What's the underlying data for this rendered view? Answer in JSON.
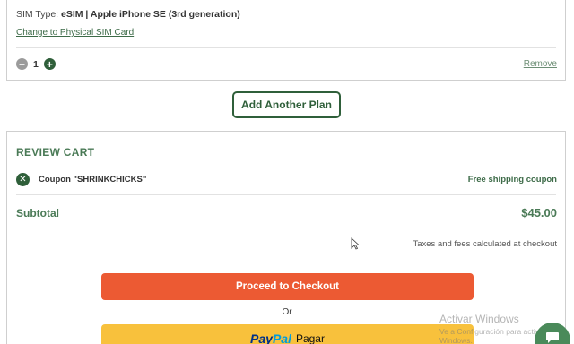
{
  "plan": {
    "sim_type_label": "SIM Type:",
    "sim_type_value": "eSIM | Apple iPhone SE (3rd generation)",
    "change_sim_link": "Change to Physical SIM Card",
    "quantity": "1",
    "remove_link": "Remove"
  },
  "add_plan_button": "Add Another Plan",
  "review": {
    "title": "REVIEW CART",
    "coupon_label": "Coupon \"SHRINKCHICKS\"",
    "coupon_type": "Free shipping coupon",
    "subtotal_label": "Subtotal",
    "subtotal_value": "$45.00",
    "taxes_note": "Taxes and fees calculated at checkout",
    "checkout_button": "Proceed to Checkout",
    "or_text": "Or",
    "paypal": {
      "logo_pay": "Pay",
      "logo_pal": "Pal",
      "action": "Pagar"
    }
  },
  "watermark": {
    "title": "Activar Windows",
    "subtitle": "Ve a Configuración para activar Windows."
  },
  "icons": {
    "minus": "minus-circle-icon",
    "plus": "plus-circle-icon",
    "coupon_remove": "close-circle-icon",
    "chat": "chat-icon"
  },
  "colors": {
    "brand_green": "#2f5f3a",
    "accent_green": "#4a7a56",
    "checkout_orange": "#ec5a33",
    "paypal_yellow": "#f8c13c"
  }
}
